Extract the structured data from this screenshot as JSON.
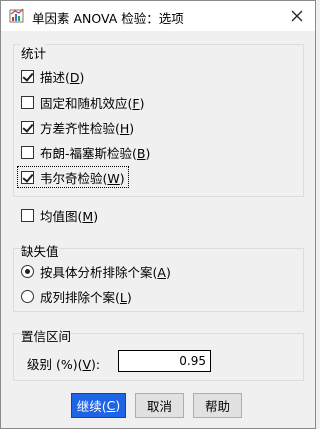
{
  "window": {
    "title": "单因素 ANOVA 检验：选项"
  },
  "statistics": {
    "title": "统计",
    "items": [
      {
        "pre": "描述(",
        "key": "D",
        "post": ")",
        "checked": true
      },
      {
        "pre": "固定和随机效应(",
        "key": "F",
        "post": ")",
        "checked": false
      },
      {
        "pre": "方差齐性检验(",
        "key": "H",
        "post": ")",
        "checked": true
      },
      {
        "pre": "布朗-福塞斯检验(",
        "key": "B",
        "post": ")",
        "checked": false
      },
      {
        "pre": "韦尔奇检验(",
        "key": "W",
        "post": ")",
        "checked": true
      }
    ]
  },
  "means_plot": {
    "pre": "均值图(",
    "key": "M",
    "post": ")",
    "checked": false
  },
  "missing": {
    "title": "缺失值",
    "options": [
      {
        "pre": "按具体分析排除个案(",
        "key": "A",
        "post": ")",
        "selected": true
      },
      {
        "pre": "成列排除个案(",
        "key": "L",
        "post": ")",
        "selected": false
      }
    ]
  },
  "confidence": {
    "title": "置信区间",
    "label_pre": "级别 (%)(",
    "label_key": "V",
    "label_post": "):",
    "value": "0.95"
  },
  "buttons": {
    "continue": {
      "pre": "继续(",
      "key": "C",
      "post": ")"
    },
    "cancel": "取消",
    "help": "帮助"
  },
  "colors": {
    "primary_button": "#1e64e6",
    "window_bg": "#f0f0f0"
  }
}
